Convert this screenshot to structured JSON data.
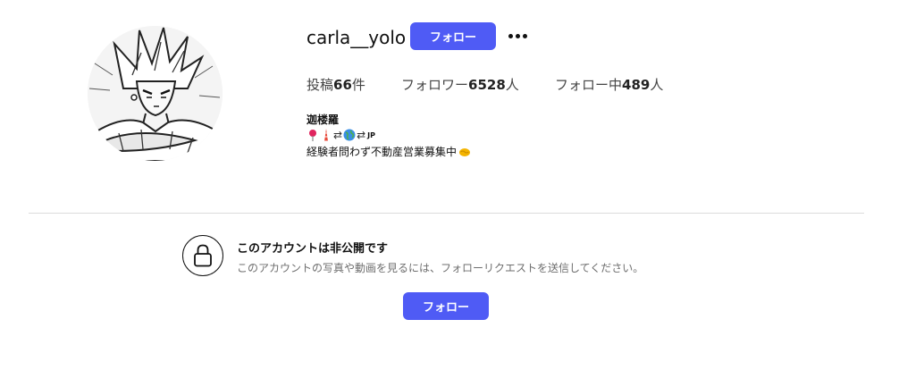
{
  "profile": {
    "username": "carla__yolo",
    "follow_label": "フォロー",
    "more_label": "•••",
    "stats": {
      "posts_prefix": "投稿",
      "posts_count": "66",
      "posts_suffix": "件",
      "followers_prefix": "フォロワー",
      "followers_count": "6528",
      "followers_suffix": "人",
      "following_prefix": "フォロー中",
      "following_count": "489",
      "following_suffix": "人"
    },
    "bio": {
      "name": "迦楼羅",
      "line1_icons": [
        "round-pushpin-icon",
        "tokyo-tower-icon",
        "arrows-icon",
        "globe-icon",
        "arrows-icon"
      ],
      "line1_arrow": "⇄",
      "line1_jp": "JP",
      "line2_text": "経験者問わず不動産営業募集中",
      "line2_icon": "handshake-icon"
    }
  },
  "private": {
    "title": "このアカウントは非公開です",
    "description": "このアカウントの写真や動画を見るには、フォローリクエストを送信してください。",
    "follow_label": "フォロー"
  },
  "colors": {
    "accent": "#4f5bf5",
    "divider": "#dbdbdb",
    "muted_text": "#6e6e6e"
  }
}
